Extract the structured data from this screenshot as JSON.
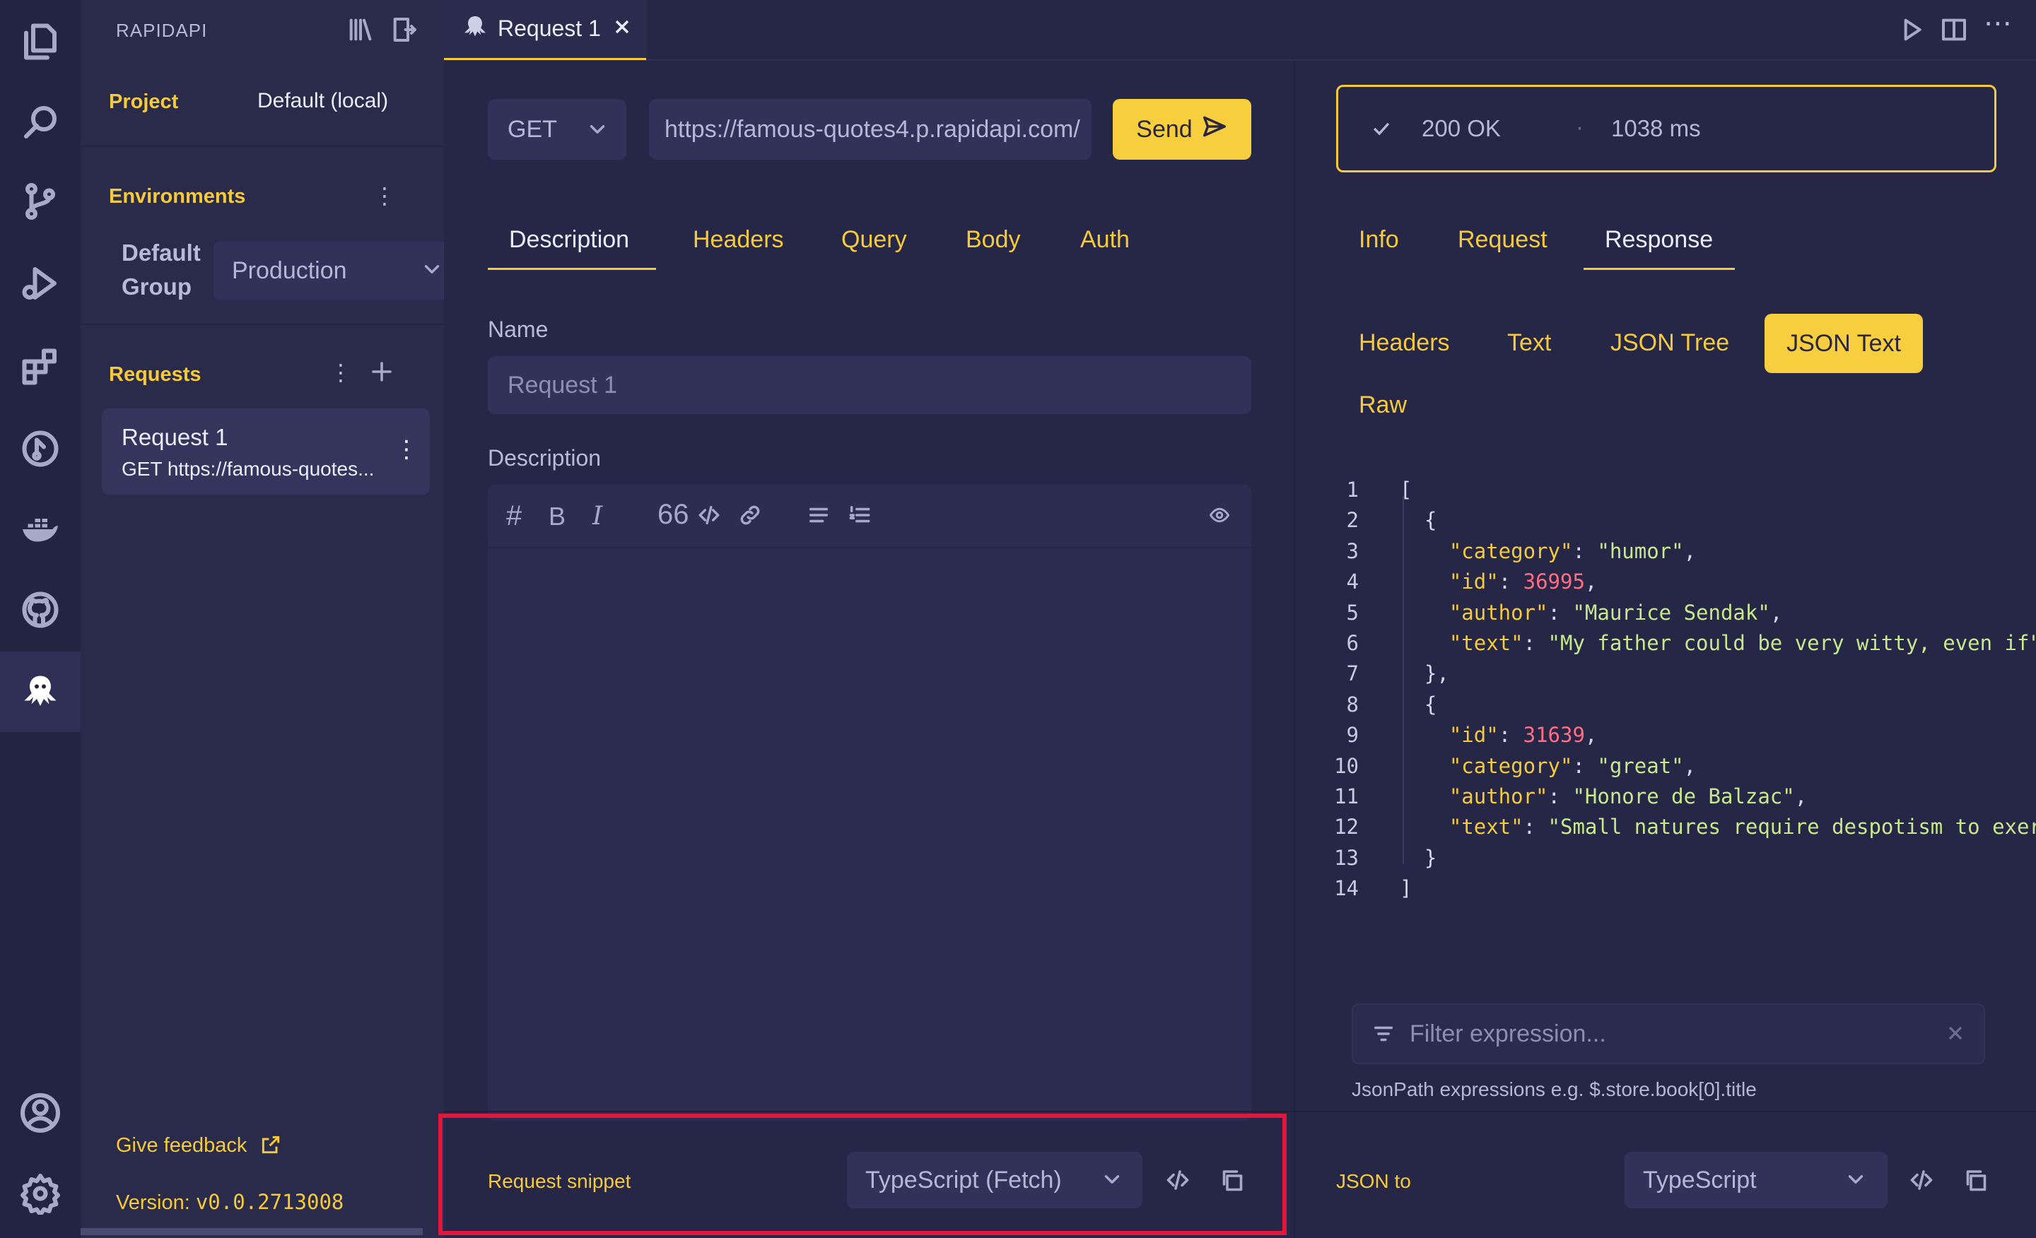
{
  "sidebar": {
    "title": "RAPIDAPI",
    "project_label": "Project",
    "project_value": "Default (local)",
    "environments_label": "Environments",
    "env_group_label": "Default Group",
    "env_select": "Production",
    "requests_label": "Requests",
    "request_item": {
      "name": "Request 1",
      "subtitle": "GET https://famous-quotes..."
    },
    "feedback": "Give feedback",
    "version_label": "Version: ",
    "version_value": "v0.0.2713008"
  },
  "tabs": {
    "active": "Request 1"
  },
  "request": {
    "method": "GET",
    "url": "https://famous-quotes4.p.rapidapi.com/",
    "send_label": "Send",
    "tabs": [
      "Description",
      "Headers",
      "Query",
      "Body",
      "Auth"
    ],
    "name_label": "Name",
    "name_placeholder": "Request 1",
    "description_label": "Description",
    "snippet_label": "Request snippet",
    "snippet_select": "TypeScript (Fetch)"
  },
  "response": {
    "status": "200 OK",
    "time": "1038 ms",
    "tabs": [
      "Info",
      "Request",
      "Response"
    ],
    "subtabs": [
      "Headers",
      "Text",
      "JSON Tree",
      "JSON Text",
      "Raw"
    ],
    "filter_placeholder": "Filter expression...",
    "filter_hint": "JsonPath expressions e.g. $.store.book[0].title",
    "json_to_label": "JSON to",
    "json_to_select": "TypeScript",
    "code_lines": [
      {
        "n": "1",
        "t": "["
      },
      {
        "n": "2",
        "t": "  {"
      },
      {
        "n": "3",
        "key": "category",
        "str": "humor"
      },
      {
        "n": "4",
        "key": "id",
        "num": "36995"
      },
      {
        "n": "5",
        "key": "author",
        "str": "Maurice Sendak"
      },
      {
        "n": "6",
        "key": "text",
        "str": "My father could be very witty, even if"
      },
      {
        "n": "7",
        "t": "  },"
      },
      {
        "n": "8",
        "t": "  {"
      },
      {
        "n": "9",
        "key": "id",
        "num": "31639"
      },
      {
        "n": "10",
        "key": "category",
        "str": "great"
      },
      {
        "n": "11",
        "key": "author",
        "str": "Honore de Balzac"
      },
      {
        "n": "12",
        "key": "text",
        "str": "Small natures require despotism to exer"
      },
      {
        "n": "13",
        "t": "  }"
      },
      {
        "n": "14",
        "t": "]"
      }
    ]
  },
  "colors": {
    "accent": "#f5ca3b",
    "highlight_border": "#e3173d",
    "background": "#262646"
  }
}
